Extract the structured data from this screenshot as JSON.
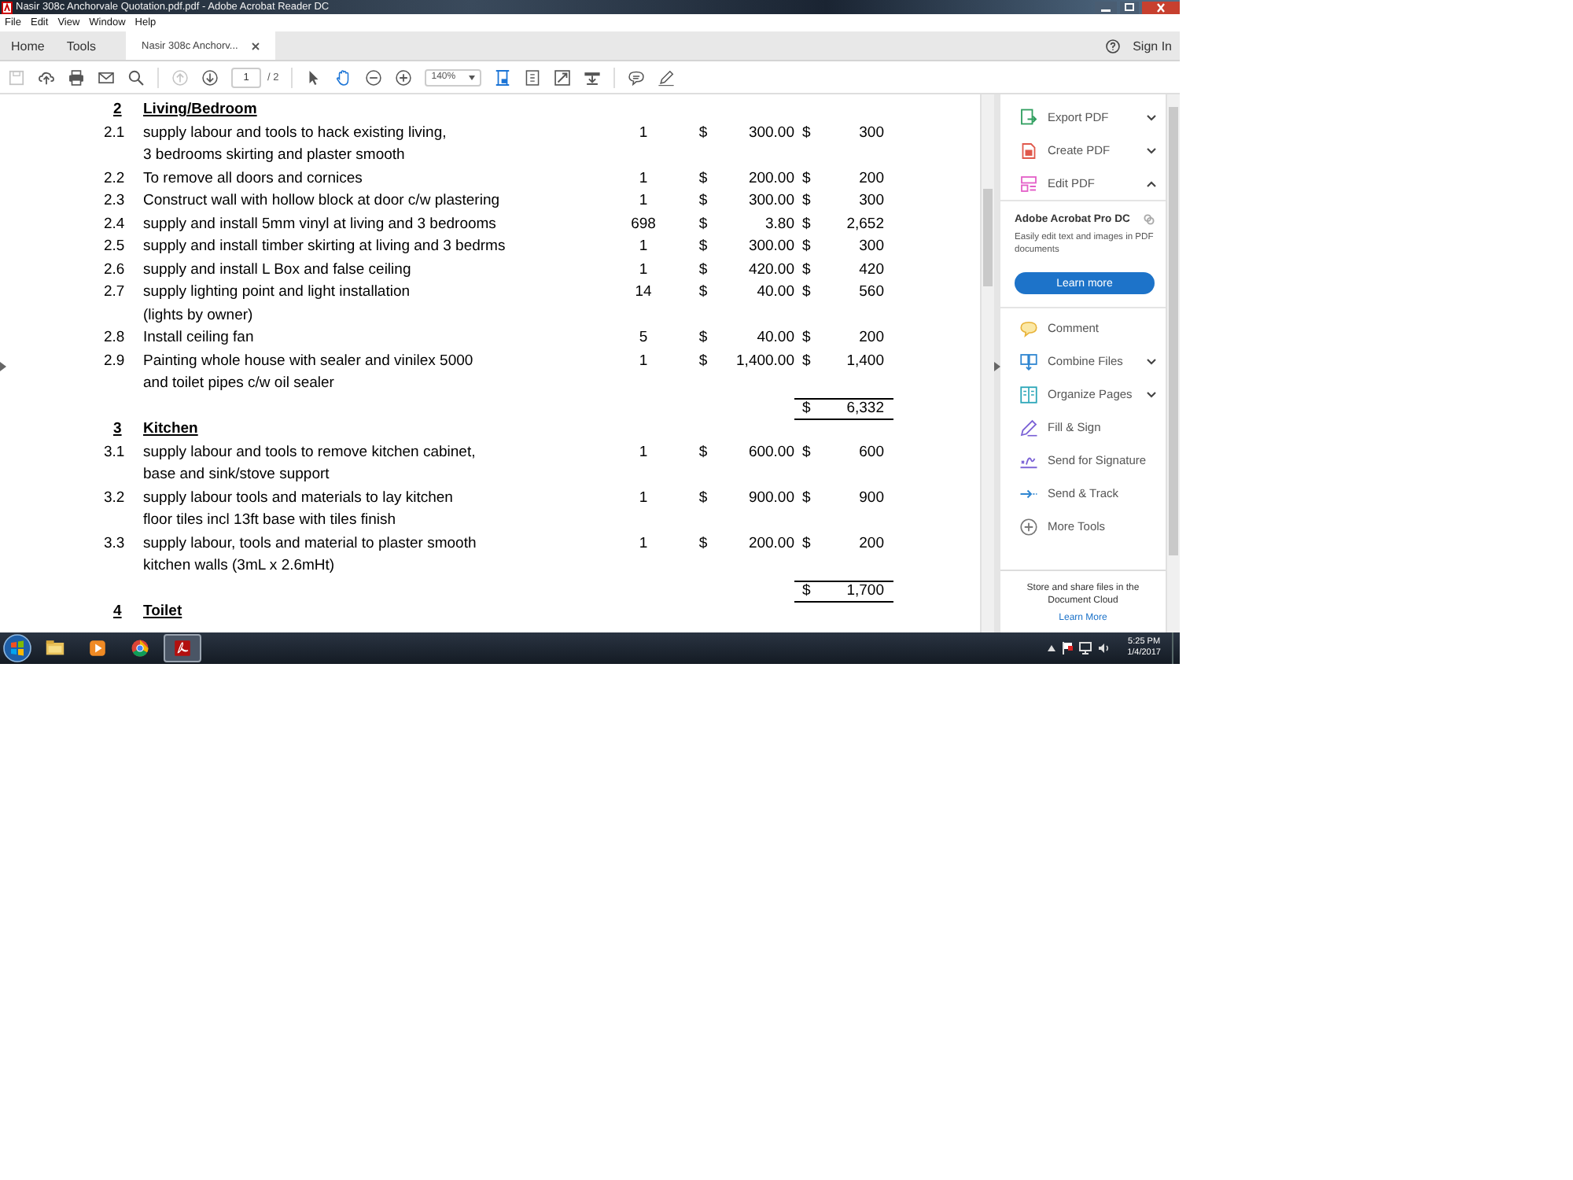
{
  "window": {
    "title": "Nasir 308c Anchorvale Quotation.pdf.pdf - Adobe Acrobat Reader DC"
  },
  "menu": [
    "File",
    "Edit",
    "View",
    "Window",
    "Help"
  ],
  "tabs": [
    {
      "label": "Home",
      "selected": false,
      "closable": false
    },
    {
      "label": "Tools",
      "selected": false,
      "closable": false
    },
    {
      "label": "Nasir 308c Anchorv...",
      "selected": true,
      "closable": true
    }
  ],
  "sign_in": "Sign In",
  "toolbar": {
    "file_tools": [
      {
        "kind": "save",
        "disabled": true,
        "selected": false
      },
      {
        "kind": "upload",
        "disabled": false,
        "selected": false
      },
      {
        "kind": "print",
        "disabled": false,
        "selected": false
      },
      {
        "kind": "mail",
        "disabled": false,
        "selected": false
      },
      {
        "kind": "search",
        "disabled": false,
        "selected": false
      }
    ],
    "nav_tools": [
      {
        "kind": "prev",
        "disabled": true,
        "selected": false
      },
      {
        "kind": "next",
        "disabled": false,
        "selected": false
      }
    ],
    "page": "1",
    "page_total": "/ 2",
    "view_tools": [
      {
        "kind": "select",
        "disabled": false,
        "selected": false
      },
      {
        "kind": "hand",
        "disabled": false,
        "selected": true
      },
      {
        "kind": "zoom_out",
        "disabled": false,
        "selected": false
      },
      {
        "kind": "zoom_in",
        "disabled": false,
        "selected": false
      }
    ],
    "zoom": "140%",
    "page_tools": [
      {
        "kind": "fit",
        "disabled": false,
        "selected": true
      },
      {
        "kind": "page_view",
        "disabled": false,
        "selected": false
      },
      {
        "kind": "full_screen",
        "disabled": false,
        "selected": false
      },
      {
        "kind": "read_tools",
        "disabled": false,
        "selected": false
      }
    ],
    "annotate_tools": [
      {
        "kind": "comment",
        "disabled": false,
        "selected": false
      },
      {
        "kind": "pen",
        "disabled": false,
        "selected": false
      }
    ]
  },
  "document": {
    "sections": [
      {
        "number": "2",
        "title": "Living/Bedroom",
        "items": [
          {
            "number": "2.1",
            "description": [
              "supply labour and tools to hack existing living,",
              "3 bedrooms skirting and plaster smooth"
            ],
            "qty": "1",
            "unit_currency": "$",
            "unit_price": "300.00",
            "amount_currency": "$",
            "amount": "300"
          },
          {
            "number": "2.2",
            "description": [
              "To remove all doors and cornices"
            ],
            "qty": "1",
            "unit_currency": "$",
            "unit_price": "200.00",
            "amount_currency": "$",
            "amount": "200"
          },
          {
            "number": "2.3",
            "description": [
              "Construct wall with hollow block at door c/w plastering"
            ],
            "qty": "1",
            "unit_currency": "$",
            "unit_price": "300.00",
            "amount_currency": "$",
            "amount": "300"
          },
          {
            "number": "2.4",
            "description": [
              "supply and install 5mm vinyl at living and 3 bedrooms"
            ],
            "qty": "698",
            "unit_currency": "$",
            "unit_price": "3.80",
            "amount_currency": "$",
            "amount": "2,652"
          },
          {
            "number": "2.5",
            "description": [
              "supply and install timber skirting at living and 3 bedrms"
            ],
            "qty": "1",
            "unit_currency": "$",
            "unit_price": "300.00",
            "amount_currency": "$",
            "amount": "300"
          },
          {
            "number": "2.6",
            "description": [
              "supply and install L Box and false ceiling"
            ],
            "qty": "1",
            "unit_currency": "$",
            "unit_price": "420.00",
            "amount_currency": "$",
            "amount": "420"
          },
          {
            "number": "2.7",
            "description": [
              "supply lighting point and light installation",
              "(lights by owner)"
            ],
            "qty": "14",
            "unit_currency": "$",
            "unit_price": "40.00",
            "amount_currency": "$",
            "amount": "560"
          },
          {
            "number": "2.8",
            "description": [
              "Install ceiling fan"
            ],
            "qty": "5",
            "unit_currency": "$",
            "unit_price": "40.00",
            "amount_currency": "$",
            "amount": "200"
          },
          {
            "number": "2.9",
            "description": [
              "Painting whole house with sealer and vinilex 5000",
              "and toilet pipes c/w oil sealer"
            ],
            "qty": "1",
            "unit_currency": "$",
            "unit_price": "1,400.00",
            "amount_currency": "$",
            "amount": "1,400"
          }
        ],
        "subtotal": {
          "currency": "$",
          "amount": "6,332"
        }
      },
      {
        "number": "3",
        "title": "Kitchen",
        "items": [
          {
            "number": "3.1",
            "description": [
              "supply labour and tools to remove kitchen cabinet,",
              "base and sink/stove support"
            ],
            "qty": "1",
            "unit_currency": "$",
            "unit_price": "600.00",
            "amount_currency": "$",
            "amount": "600"
          },
          {
            "number": "3.2",
            "description": [
              "supply labour tools and materials to lay kitchen",
              "floor tiles incl 13ft base with tiles finish"
            ],
            "qty": "1",
            "unit_currency": "$",
            "unit_price": "900.00",
            "amount_currency": "$",
            "amount": "900"
          },
          {
            "number": "3.3",
            "description": [
              "supply labour, tools and material to plaster smooth",
              "kitchen walls (3mL x 2.6mHt)"
            ],
            "qty": "1",
            "unit_currency": "$",
            "unit_price": "200.00",
            "amount_currency": "$",
            "amount": "200"
          }
        ],
        "subtotal": {
          "currency": "$",
          "amount": "1,700"
        }
      },
      {
        "number": "4",
        "title": "Toilet"
      }
    ]
  },
  "tools_panel": {
    "top_tools": [
      {
        "kind": "export",
        "label": "Export PDF",
        "expanded": false
      },
      {
        "kind": "create",
        "label": "Create PDF",
        "expanded": false
      },
      {
        "kind": "edit",
        "label": "Edit PDF",
        "expanded": true
      }
    ],
    "promo": {
      "title": "Adobe Acrobat Pro DC",
      "text": "Easily edit text and images in PDF documents",
      "button": "Learn more"
    },
    "tools": [
      {
        "kind": "comment",
        "label": "Comment",
        "has_menu": false
      },
      {
        "kind": "combine",
        "label": "Combine Files",
        "has_menu": true
      },
      {
        "kind": "organize",
        "label": "Organize Pages",
        "has_menu": true
      },
      {
        "kind": "fill_sign",
        "label": "Fill & Sign",
        "has_menu": false
      },
      {
        "kind": "send_signature",
        "label": "Send for Signature",
        "has_menu": false
      },
      {
        "kind": "send_track",
        "label": "Send & Track",
        "has_menu": false
      },
      {
        "kind": "more",
        "label": "More Tools",
        "has_menu": false
      }
    ],
    "footer": {
      "text": "Store and share files in the Document Cloud",
      "link": "Learn More"
    }
  },
  "taskbar": {
    "apps": [
      {
        "kind": "explorer",
        "selected": false
      },
      {
        "kind": "media",
        "selected": false
      },
      {
        "kind": "chrome",
        "selected": false
      },
      {
        "kind": "acrobat",
        "selected": true
      }
    ],
    "time": "5:25 PM",
    "date": "1/4/2017"
  }
}
